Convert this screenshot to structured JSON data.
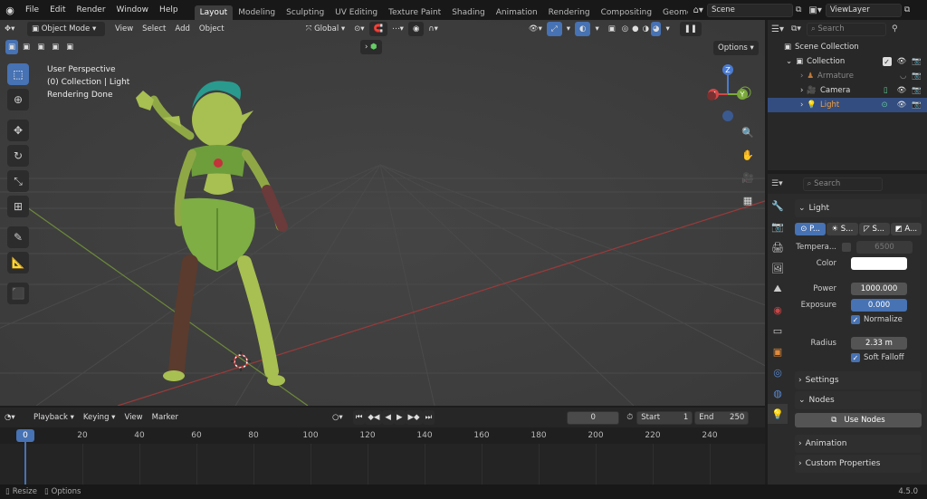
{
  "menu": {
    "file": "File",
    "edit": "Edit",
    "render": "Render",
    "window": "Window",
    "help": "Help"
  },
  "workspaces": [
    "Layout",
    "Modeling",
    "Sculpting",
    "UV Editing",
    "Texture Paint",
    "Shading",
    "Animation",
    "Rendering",
    "Compositing",
    "Geometry N"
  ],
  "scene": {
    "name": "Scene",
    "view_layer": "ViewLayer"
  },
  "viewport": {
    "mode": "Object Mode",
    "view": "View",
    "select": "Select",
    "add": "Add",
    "object": "Object",
    "transform": "Global",
    "options": "Options",
    "overlay_line1": "User Perspective",
    "overlay_line2": "(0) Collection | Light",
    "overlay_line3": "Rendering Done"
  },
  "gizmo": {
    "z": "Z",
    "y": "Y",
    "x": "X"
  },
  "outliner": {
    "search_placeholder": "Search",
    "scene_collection": "Scene Collection",
    "collection": "Collection",
    "items": [
      {
        "label": "Armature"
      },
      {
        "label": "Camera"
      },
      {
        "label": "Light"
      }
    ]
  },
  "properties": {
    "search_placeholder": "Search",
    "light_panel": "Light",
    "types": [
      {
        "label": "P..."
      },
      {
        "label": "S..."
      },
      {
        "label": "S..."
      },
      {
        "label": "A..."
      }
    ],
    "temperature_label": "Tempera...",
    "temperature_value": "6500",
    "color_label": "Color",
    "power_label": "Power",
    "power_value": "1000.000",
    "exposure_label": "Exposure",
    "exposure_value": "0.000",
    "normalize_label": "Normalize",
    "radius_label": "Radius",
    "radius_value": "2.33 m",
    "soft_falloff_label": "Soft Falloff",
    "settings_panel": "Settings",
    "nodes_panel": "Nodes",
    "use_nodes_button": "Use Nodes",
    "animation_panel": "Animation",
    "custom_props_panel": "Custom Properties"
  },
  "timeline": {
    "playback": "Playback",
    "keying": "Keying",
    "view": "View",
    "marker": "Marker",
    "current_frame": "0",
    "start_label": "Start",
    "start_value": "1",
    "end_label": "End",
    "end_value": "250",
    "ticks": [
      "0",
      "20",
      "40",
      "60",
      "80",
      "100",
      "120",
      "140",
      "160",
      "180",
      "200",
      "220",
      "240"
    ]
  },
  "status": {
    "resize": "Resize",
    "options": "Options",
    "version": "4.5.0"
  }
}
